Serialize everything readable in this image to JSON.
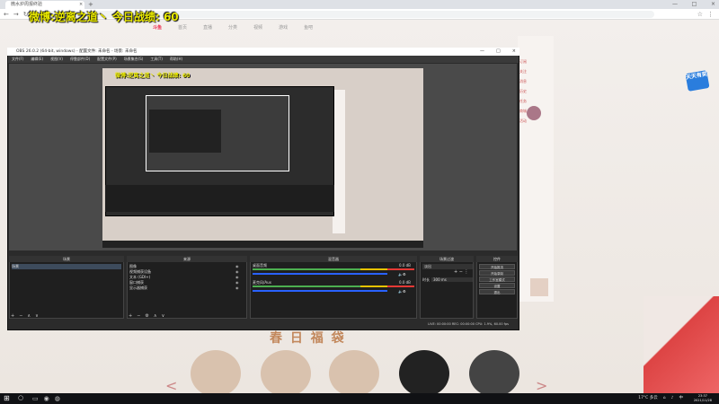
{
  "browser": {
    "tab_title": "微水炉周报终验",
    "tab_close": "×",
    "new_tab": "+",
    "url": "",
    "window_controls": [
      "—",
      "□",
      "×"
    ],
    "nav": [
      "←",
      "→",
      "↻"
    ],
    "toolbar_icons": [
      "☆",
      "⋮"
    ]
  },
  "overlay": {
    "text": "微博:逆离之道丶  今日战绩: 60"
  },
  "site": {
    "logo": "斗鱼",
    "nav": [
      "首页",
      "直播",
      "分类",
      "视频",
      "游戏",
      "鱼吧"
    ],
    "right_items": [
      "订阅",
      "关注",
      "消息",
      "历史",
      "任务",
      "商城",
      "活动"
    ],
    "side_badge": "天天有奖",
    "banner": "春 日 福 袋"
  },
  "obs": {
    "title": "OBS 26.0.2 (64-bit, windows) - 配置文件: 未命名 - 场景: 未命名",
    "window_controls": [
      "—",
      "□",
      "×"
    ],
    "menu": [
      "文件(F)",
      "编辑(E)",
      "视图(V)",
      "停靠部件(D)",
      "配置文件(P)",
      "场景集合(S)",
      "工具(T)",
      "帮助(H)"
    ],
    "capture_title": "微博:逆离之道丶  今日战绩: 60",
    "docks": {
      "scenes": {
        "title": "场景",
        "items": [
          "场景"
        ]
      },
      "sources": {
        "title": "来源",
        "items": [
          "图像",
          "视频捕获设备",
          "文本 (GDI+)",
          "窗口捕获",
          "显示器捕获"
        ]
      },
      "mixer": {
        "title": "混音器",
        "channels": [
          {
            "name": "桌面音频",
            "level": "0.0 dB"
          },
          {
            "name": "麦克风/Aux",
            "level": "0.0 dB"
          }
        ]
      },
      "transitions": {
        "title": "场景过渡",
        "type": "淡出",
        "duration_label": "时长",
        "duration": "300 ms"
      },
      "controls": {
        "title": "控件",
        "buttons": [
          "开始推流",
          "开始录制",
          "工作室模式",
          "设置",
          "退出"
        ]
      }
    },
    "status": "LIVE: 00:00:00   REC: 00:00:00   CPU: 1.9%, 60.00 fps",
    "dock_buttons": [
      "+",
      "−",
      "∧",
      "∨"
    ]
  },
  "taskbar": {
    "start": "⊞",
    "search": "○",
    "apps": [
      "▭",
      "◉",
      "◍"
    ],
    "weather": "17°C 多云",
    "ime": "中",
    "clock_time": "23:37",
    "clock_date": "2021/11/28"
  },
  "colors": {
    "overlay_yellow": "#e8e800",
    "obs_dark": "#2b2b2b",
    "meter_green": "#4caf50",
    "meter_red": "#e53935",
    "meter_blue": "#2962ff"
  }
}
